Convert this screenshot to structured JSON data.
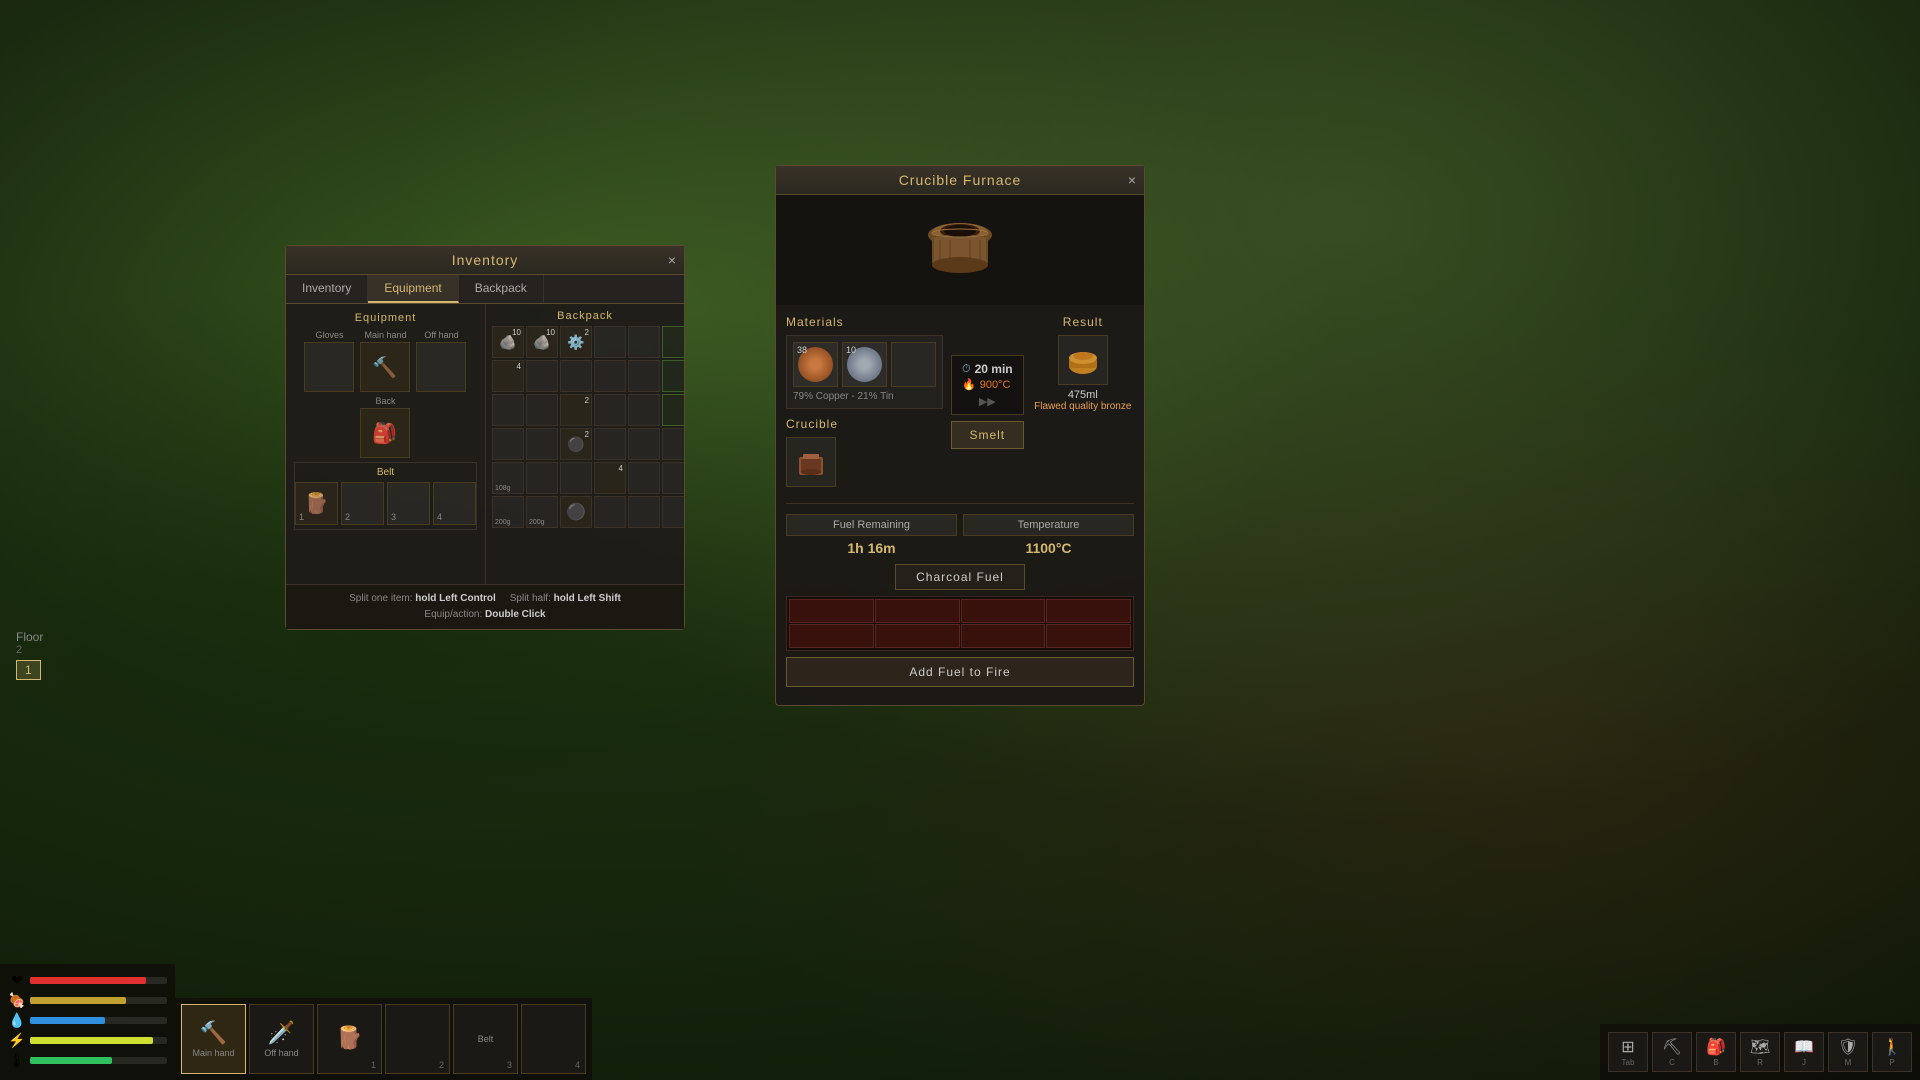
{
  "background": {
    "description": "Forest scene background"
  },
  "inventory": {
    "title": "Inventory",
    "close_label": "×",
    "tabs": [
      {
        "label": "Inventory",
        "active": false
      },
      {
        "label": "Equipment",
        "active": true
      },
      {
        "label": "Backpack",
        "active": false
      }
    ],
    "equipment": {
      "section_title": "Equipment",
      "gloves_label": "Gloves",
      "main_hand_label": "Main hand",
      "off_hand_label": "Off hand",
      "back_label": "Back",
      "belt_label": "Belt",
      "belt_slots": [
        {
          "num": "1",
          "has_item": true
        },
        {
          "num": "2",
          "has_item": false
        },
        {
          "num": "3",
          "has_item": false
        },
        {
          "num": "4",
          "has_item": false
        }
      ]
    },
    "backpack": {
      "section_title": "Backpack",
      "items": [
        {
          "has_item": true,
          "count": "10",
          "icon": "🪨"
        },
        {
          "has_item": true,
          "count": "10",
          "icon": "🪨"
        },
        {
          "has_item": true,
          "count": "2",
          "icon": "⚙️"
        },
        {
          "has_item": false
        },
        {
          "has_item": false
        },
        {
          "has_item": false
        },
        {
          "has_item": true,
          "count": "4",
          "icon": ""
        },
        {
          "has_item": false
        },
        {
          "has_item": false
        },
        {
          "has_item": false
        },
        {
          "has_item": false
        },
        {
          "has_item": false
        },
        {
          "has_item": false
        },
        {
          "has_item": false
        },
        {
          "has_item": true,
          "count": "2",
          "icon": ""
        },
        {
          "has_item": false
        },
        {
          "has_item": false
        },
        {
          "has_item": false
        },
        {
          "has_item": false
        },
        {
          "has_item": false
        },
        {
          "has_item": true,
          "count": "2",
          "icon": "⚫"
        },
        {
          "has_item": false
        },
        {
          "has_item": false
        },
        {
          "has_item": false
        },
        {
          "has_item": false
        },
        {
          "has_item": false
        },
        {
          "has_item": false
        },
        {
          "has_item": true,
          "count": "4",
          "icon": ""
        },
        {
          "has_item": false
        },
        {
          "has_item": false
        }
      ],
      "weight_1": "108g",
      "weight_2": "200g",
      "weight_3": "200g"
    },
    "statusbar": {
      "split_one": "Split one item:",
      "split_one_key": "hold Left Control",
      "split_half": "Split half:",
      "split_half_key": "hold Left Shift",
      "equip": "Equip/action:",
      "equip_key": "Double Click"
    }
  },
  "furnace": {
    "title": "Crucible Furnace",
    "close_label": "×",
    "materials_header": "Materials",
    "material_1_count": "38",
    "material_2_count": "10",
    "material_pct": "79% Copper - 21% Tin",
    "crucible_header": "Crucible",
    "result_header": "Result",
    "smelt_time": "20 min",
    "smelt_temp": "900°C",
    "smelt_btn": "Smelt",
    "result_amount": "475ml",
    "result_name": "Flawed quality bronze",
    "fuel_remaining_label": "Fuel Remaining",
    "fuel_remaining_value": "1h 16m",
    "temperature_label": "Temperature",
    "temperature_value": "1100°C",
    "charcoal_label": "Charcoal Fuel",
    "add_fuel_btn": "Add Fuel to Fire"
  },
  "floor": {
    "label": "Floor",
    "level_2": "2",
    "level_1": "1"
  },
  "stats": [
    {
      "icon": "❤️",
      "color": "#e03030",
      "pct": 85
    },
    {
      "icon": "🍖",
      "color": "#c0a030",
      "pct": 70
    },
    {
      "icon": "💧",
      "color": "#3090e0",
      "pct": 55
    },
    {
      "icon": "⚡",
      "color": "#e0e030",
      "pct": 90
    },
    {
      "icon": "🌡️",
      "color": "#30c060",
      "pct": 60
    }
  ],
  "hotbar": {
    "slots": [
      {
        "label": "Main hand",
        "icon": "🔨",
        "has_item": true,
        "active": true
      },
      {
        "label": "Off hand",
        "icon": "🗡️",
        "has_item": true,
        "active": false
      },
      {
        "label": "",
        "icon": "🪵",
        "num": "1",
        "has_item": true,
        "active": false
      },
      {
        "label": "",
        "icon": "",
        "num": "2",
        "has_item": false,
        "active": false
      },
      {
        "label": "Belt",
        "icon": "",
        "num": "3",
        "has_item": false,
        "active": false
      },
      {
        "label": "",
        "icon": "",
        "num": "4",
        "has_item": false,
        "active": false
      }
    ]
  },
  "hud_icons": [
    {
      "symbol": "⊞",
      "key": "Tab"
    },
    {
      "symbol": "⛏",
      "key": "C"
    },
    {
      "symbol": "🎒",
      "key": "B"
    },
    {
      "symbol": "🗺",
      "key": "R"
    },
    {
      "symbol": "📖",
      "key": "J"
    },
    {
      "symbol": "🛡",
      "key": "M"
    },
    {
      "symbol": "🚶",
      "key": "P"
    }
  ]
}
